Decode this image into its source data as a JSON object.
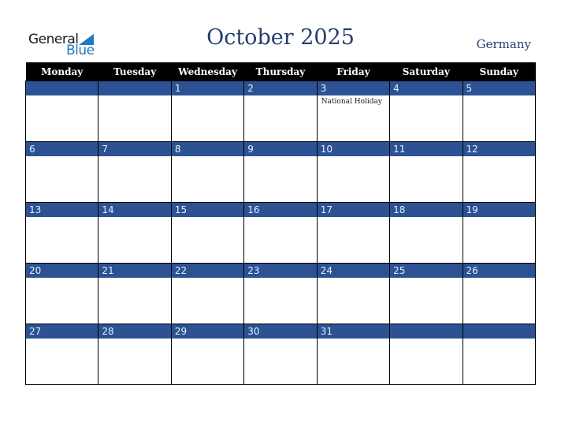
{
  "logo": {
    "line1": "General",
    "line2": "Blue"
  },
  "header": {
    "title": "October 2025",
    "country": "Germany"
  },
  "weekdays": [
    "Monday",
    "Tuesday",
    "Wednesday",
    "Thursday",
    "Friday",
    "Saturday",
    "Sunday"
  ],
  "weeks": [
    [
      {
        "d": ""
      },
      {
        "d": ""
      },
      {
        "d": "1"
      },
      {
        "d": "2"
      },
      {
        "d": "3",
        "event": "National Holiday"
      },
      {
        "d": "4"
      },
      {
        "d": "5"
      }
    ],
    [
      {
        "d": "6"
      },
      {
        "d": "7"
      },
      {
        "d": "8"
      },
      {
        "d": "9"
      },
      {
        "d": "10"
      },
      {
        "d": "11"
      },
      {
        "d": "12"
      }
    ],
    [
      {
        "d": "13"
      },
      {
        "d": "14"
      },
      {
        "d": "15"
      },
      {
        "d": "16"
      },
      {
        "d": "17"
      },
      {
        "d": "18"
      },
      {
        "d": "19"
      }
    ],
    [
      {
        "d": "20"
      },
      {
        "d": "21"
      },
      {
        "d": "22"
      },
      {
        "d": "23"
      },
      {
        "d": "24"
      },
      {
        "d": "25"
      },
      {
        "d": "26"
      }
    ],
    [
      {
        "d": "27"
      },
      {
        "d": "28"
      },
      {
        "d": "29"
      },
      {
        "d": "30"
      },
      {
        "d": "31"
      },
      {
        "d": ""
      },
      {
        "d": ""
      }
    ]
  ],
  "colors": {
    "accent": "#2c5294",
    "title": "#253c6b",
    "logo_blue": "#1f7ac4"
  }
}
